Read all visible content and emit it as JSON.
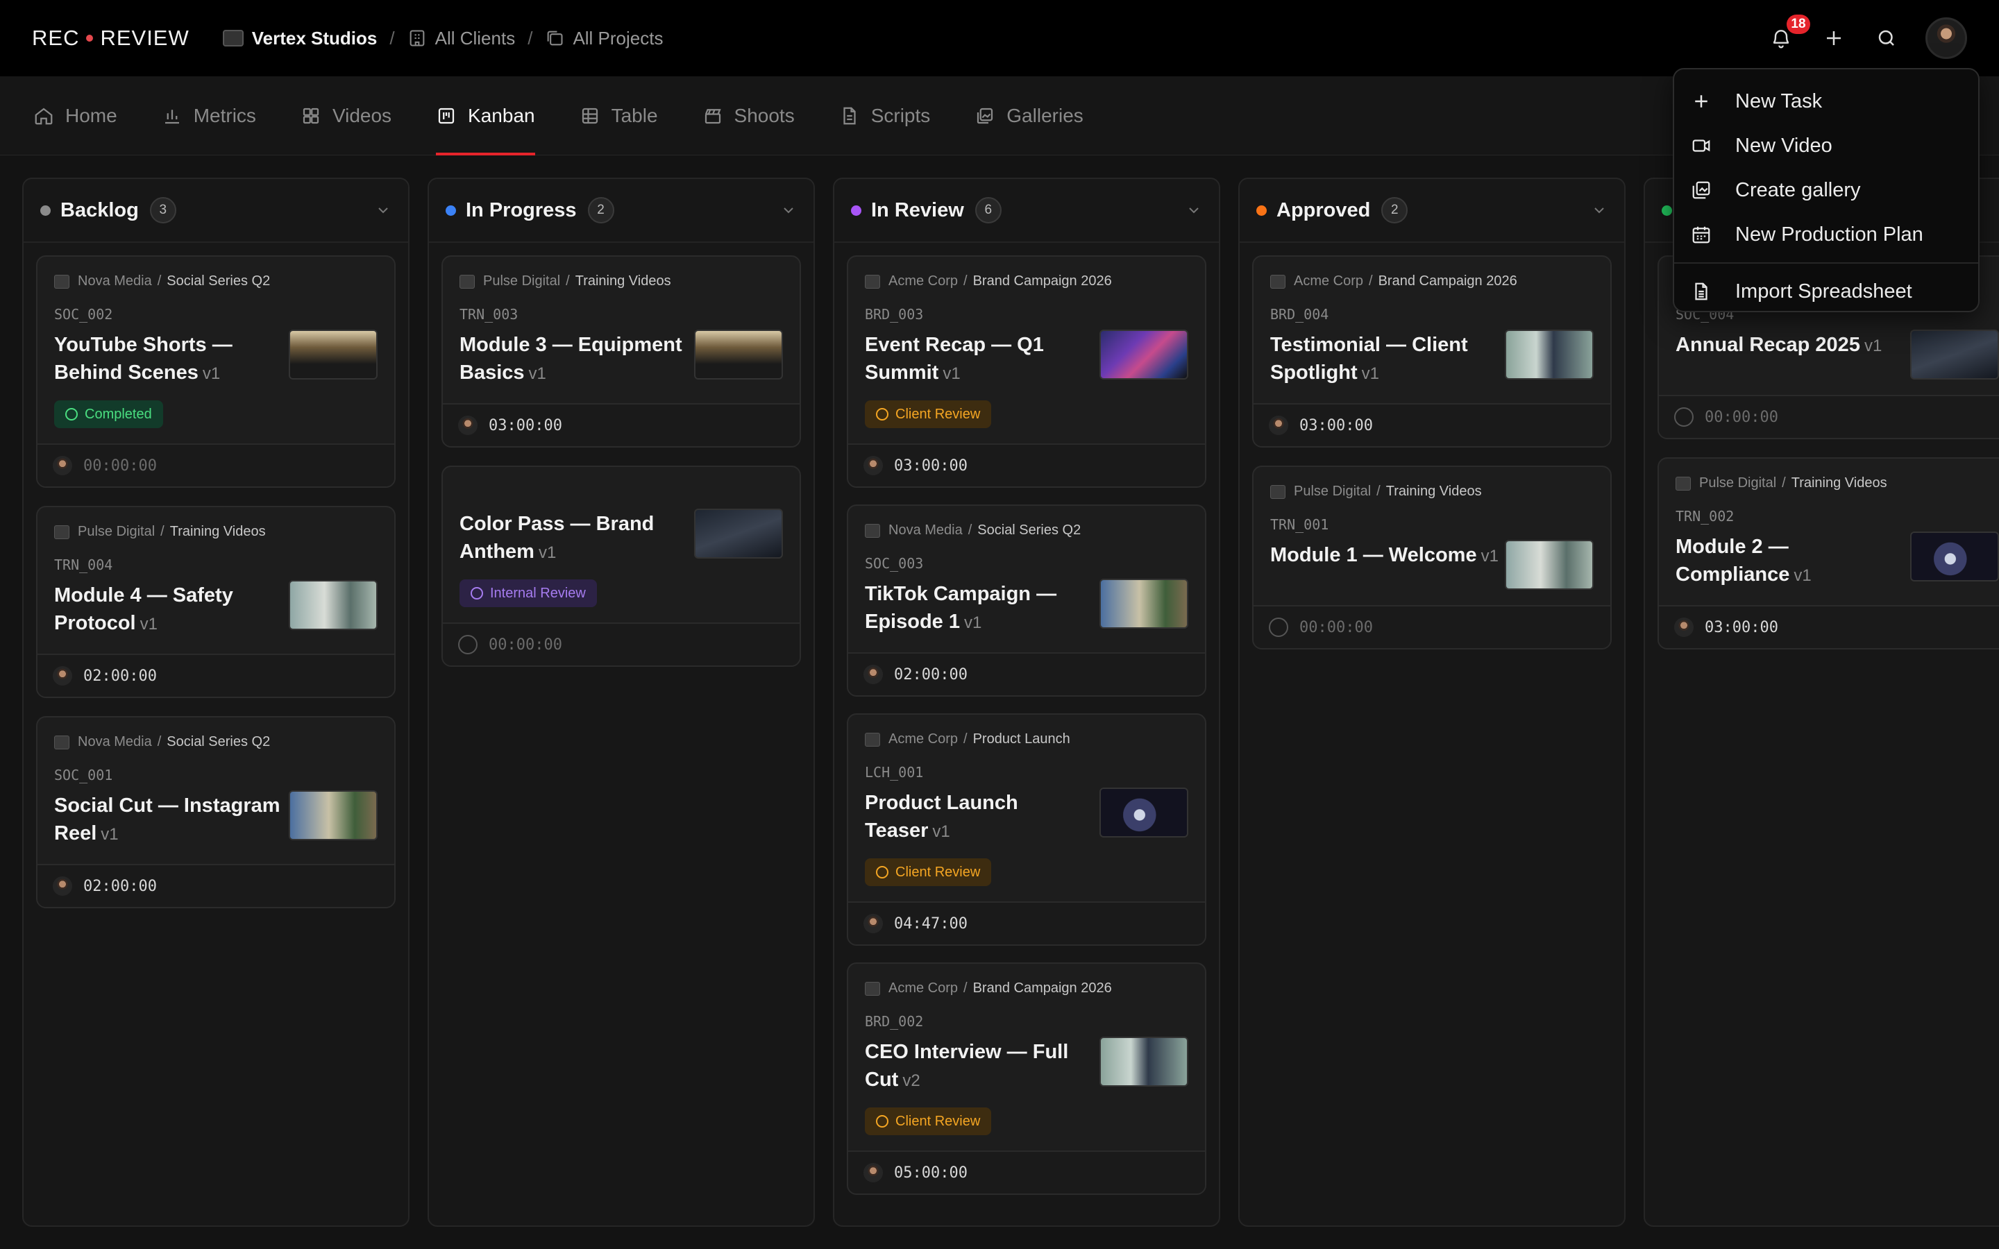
{
  "app": {
    "logo_left": "REC",
    "logo_right": "REVIEW",
    "breadcrumbs": [
      {
        "label": "Vertex Studios"
      },
      {
        "label": "All Clients"
      },
      {
        "label": "All Projects"
      }
    ],
    "notifications_count": "18"
  },
  "nav": {
    "tabs": [
      {
        "label": "Home",
        "icon": "home-icon"
      },
      {
        "label": "Metrics",
        "icon": "bar-chart-icon"
      },
      {
        "label": "Videos",
        "icon": "grid-icon"
      },
      {
        "label": "Kanban",
        "icon": "kanban-icon",
        "active": true
      },
      {
        "label": "Table",
        "icon": "table-icon"
      },
      {
        "label": "Shoots",
        "icon": "clapper-icon"
      },
      {
        "label": "Scripts",
        "icon": "document-icon"
      },
      {
        "label": "Galleries",
        "icon": "gallery-icon"
      }
    ]
  },
  "menu": {
    "items": [
      {
        "label": "New Task",
        "icon": "plus-icon"
      },
      {
        "label": "New Video",
        "icon": "video-camera-icon"
      },
      {
        "label": "Create gallery",
        "icon": "gallery-icon"
      },
      {
        "label": "New Production Plan",
        "icon": "calendar-icon"
      },
      {
        "label": "Import Spreadsheet",
        "icon": "spreadsheet-icon"
      }
    ]
  },
  "colors": {
    "accent": "#e5242b",
    "backlog": "#8b8b8b",
    "in_progress": "#3b82f6",
    "in_review": "#a855f7",
    "approved": "#f97316",
    "delivered": "#22c55e"
  },
  "columns": [
    {
      "title": "Backlog",
      "count": "3",
      "cards": [
        {
          "client": "Nova Media",
          "project": "Social Series Q2",
          "code": "SOC_002",
          "title": "YouTube Shorts — Behind Scenes",
          "version": "v1",
          "status": "Completed",
          "duration": "00:00:00"
        },
        {
          "client": "Pulse Digital",
          "project": "Training Videos",
          "code": "TRN_004",
          "title": "Module 4 — Safety Protocol",
          "version": "v1",
          "status": "",
          "duration": "02:00:00"
        },
        {
          "client": "Nova Media",
          "project": "Social Series Q2",
          "code": "SOC_001",
          "title": "Social Cut — Instagram Reel",
          "version": "v1",
          "status": "",
          "duration": "02:00:00"
        }
      ]
    },
    {
      "title": "In Progress",
      "count": "2",
      "cards": [
        {
          "client": "Pulse Digital",
          "project": "Training Videos",
          "code": "TRN_003",
          "title": "Module 3 — Equipment Basics",
          "version": "v1",
          "status": "",
          "duration": "03:00:00"
        },
        {
          "client": "",
          "project": "",
          "code": "",
          "title": "Color Pass — Brand Anthem",
          "version": "v1",
          "status": "Internal Review",
          "duration": "00:00:00"
        }
      ]
    },
    {
      "title": "In Review",
      "count": "6",
      "cards": [
        {
          "client": "Acme Corp",
          "project": "Brand Campaign 2026",
          "code": "BRD_003",
          "title": "Event Recap — Q1 Summit",
          "version": "v1",
          "status": "Client Review",
          "duration": "03:00:00"
        },
        {
          "client": "Nova Media",
          "project": "Social Series Q2",
          "code": "SOC_003",
          "title": "TikTok Campaign — Episode 1",
          "version": "v1",
          "status": "",
          "duration": "02:00:00"
        },
        {
          "client": "Acme Corp",
          "project": "Product Launch",
          "code": "LCH_001",
          "title": "Product Launch Teaser",
          "version": "v1",
          "status": "Client Review",
          "duration": "04:47:00"
        },
        {
          "client": "Acme Corp",
          "project": "Brand Campaign 2026",
          "code": "BRD_002",
          "title": "CEO Interview — Full Cut",
          "version": "v2",
          "status": "Client Review",
          "duration": "05:00:00"
        }
      ]
    },
    {
      "title": "Approved",
      "count": "2",
      "cards": [
        {
          "client": "Acme Corp",
          "project": "Brand Campaign 2026",
          "code": "BRD_004",
          "title": "Testimonial — Client Spotlight",
          "version": "v1",
          "status": "",
          "duration": "03:00:00"
        },
        {
          "client": "Pulse Digital",
          "project": "Training Videos",
          "code": "TRN_001",
          "title": "Module 1 — Welcome",
          "version": "v1",
          "status": "",
          "duration": "00:00:00"
        }
      ]
    },
    {
      "title": "",
      "count": "",
      "cards": [
        {
          "client": "",
          "project": "",
          "code": "SOC_004",
          "title": "Annual Recap 2025",
          "version": "v1",
          "status": "",
          "duration": "00:00:00"
        },
        {
          "client": "Pulse Digital",
          "project": "Training Videos",
          "code": "TRN_002",
          "title": "Module 2 — Compliance",
          "version": "v1",
          "status": "",
          "duration": "03:00:00"
        }
      ]
    }
  ]
}
